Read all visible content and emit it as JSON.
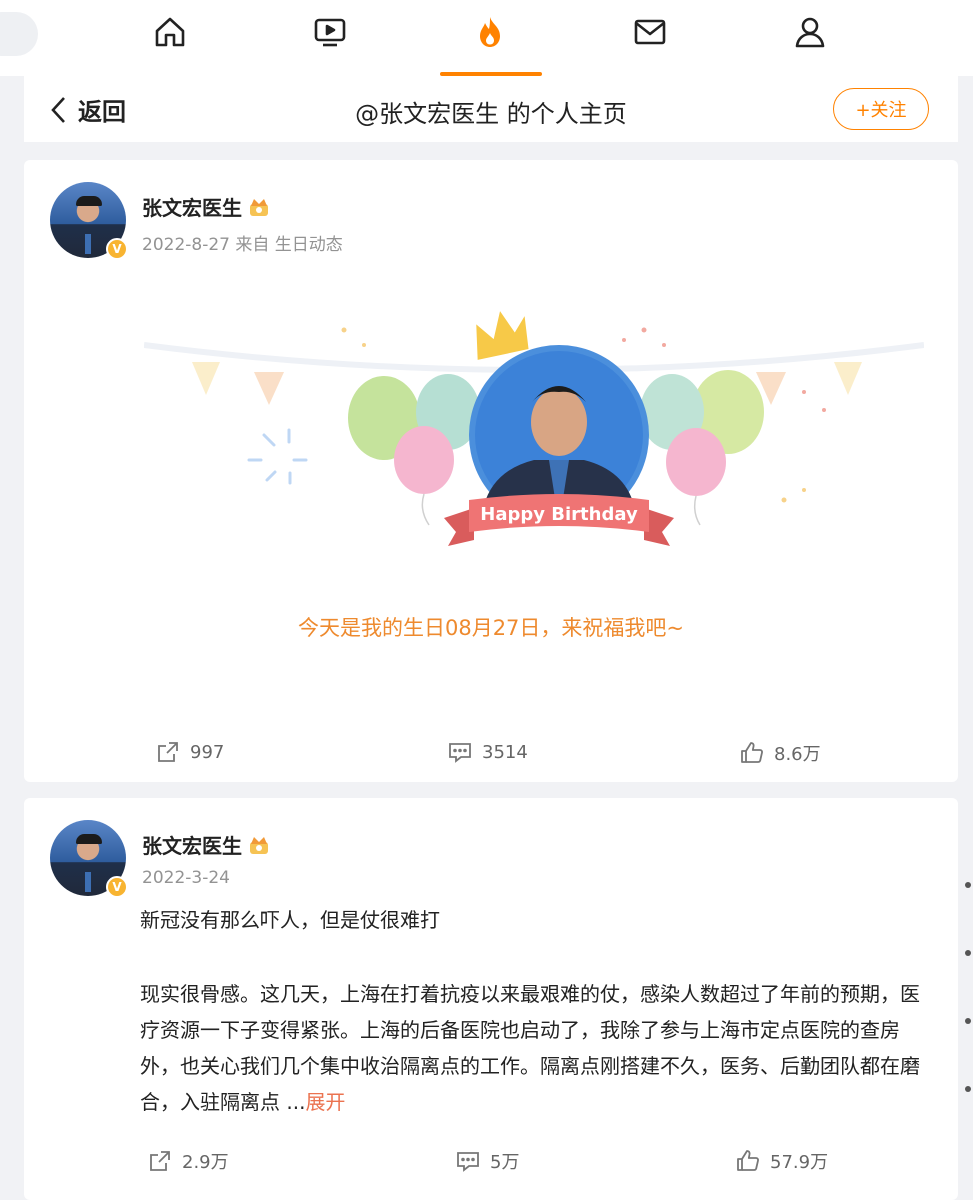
{
  "nav": {
    "items": [
      {
        "icon": "home-icon"
      },
      {
        "icon": "video-icon"
      },
      {
        "icon": "hot-icon",
        "active": true
      },
      {
        "icon": "mail-icon"
      },
      {
        "icon": "profile-icon"
      }
    ],
    "accent": "#ff8200"
  },
  "header": {
    "back_label": "返回",
    "title": "@张文宏医生 的个人主页",
    "follow_label": "+关注"
  },
  "posts": [
    {
      "author": "张文宏医生",
      "meta": "2022-8-27 来自 生日动态",
      "image_text": "Happy Birthday",
      "message": "今天是我的生日08月27日，来祝福我吧~",
      "reposts": "997",
      "comments": "3514",
      "likes": "8.6万"
    },
    {
      "author": "张文宏医生",
      "meta": "2022-3-24",
      "title": "新冠没有那么吓人，但是仗很难打",
      "body": "现实很骨感。这几天，上海在打着抗疫以来最艰难的仗，感染人数超过了年前的预期，医疗资源一下子变得紧张。上海的后备医院也启动了，我除了参与上海市定点医院的查房外，也关心我们几个集中收治隔离点的工作。隔离点刚搭建不久，医务、后勤团队都在磨合，入驻隔离点 ...",
      "expand_label": "展开",
      "reposts": "2.9万",
      "comments": "5万",
      "likes": "57.9万"
    }
  ],
  "colors": {
    "expand": "#eb7350",
    "birthday_message": "#ee8a2e",
    "verified_badge": "#f8b431"
  }
}
